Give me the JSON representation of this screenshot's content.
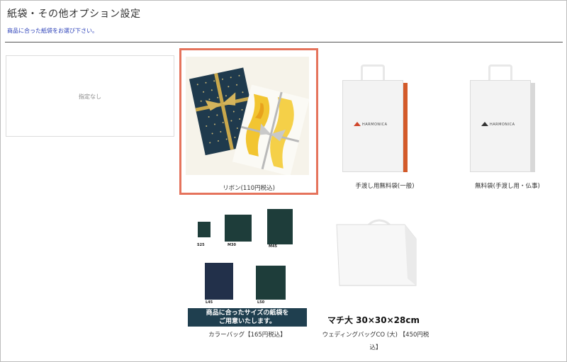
{
  "page": {
    "title": "紙袋・その他オプション設定",
    "subtitle": "商品に合った紙袋をお選び下さい。"
  },
  "options": [
    {
      "label": "指定なし",
      "selected": false
    },
    {
      "label": "リボン(110円税込)",
      "selected": true
    },
    {
      "label": "手渡し用無料袋(一般)",
      "selected": false,
      "brand": "HARMONICA"
    },
    {
      "label": "無料袋(手渡し用・仏事)",
      "selected": false,
      "brand": "HARMONICA"
    },
    {
      "label": "カラーバッグ【165円税込】",
      "selected": false
    },
    {
      "label_line1": "ウェディングバッグCO (大) 【450円税",
      "label_line2": "込】",
      "selected": false
    }
  ],
  "color_bag": {
    "sizes": [
      "S25",
      "M30",
      "M45",
      "L45",
      "L50"
    ],
    "banner_line1": "商品に合ったサイズの紙袋を",
    "banner_line2": "ご用意いたします。"
  },
  "wedding_bag": {
    "caption": "マチ大 30×30×28cm"
  },
  "colors": {
    "selected_border": "#e5735c",
    "subtitle_text": "#2a3fb8",
    "bag_dark_green": "#1e3d3a",
    "bag_navy": "#22304a",
    "harmonica_accent": "#d0452a"
  }
}
